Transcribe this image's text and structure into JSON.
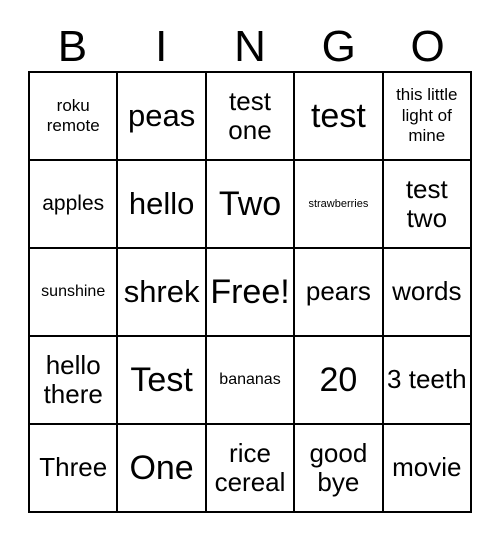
{
  "card": {
    "title": "BINGO",
    "headers": [
      "B",
      "I",
      "N",
      "G",
      "O"
    ],
    "rows": [
      [
        {
          "text": "roku remote",
          "size": "s"
        },
        {
          "text": "peas",
          "size": "xl"
        },
        {
          "text": "test one",
          "size": "l"
        },
        {
          "text": "test",
          "size": "xxl"
        },
        {
          "text": "this little light of mine",
          "size": "s"
        }
      ],
      [
        {
          "text": "apples",
          "size": "m"
        },
        {
          "text": "hello",
          "size": "xl"
        },
        {
          "text": "Two",
          "size": "xxl"
        },
        {
          "text": "strawberries",
          "size": "xxs"
        },
        {
          "text": "test two",
          "size": "l"
        }
      ],
      [
        {
          "text": "sunshine",
          "size": "xs"
        },
        {
          "text": "shrek",
          "size": "xl"
        },
        {
          "text": "Free!",
          "size": "xxl"
        },
        {
          "text": "pears",
          "size": "l"
        },
        {
          "text": "words",
          "size": "l"
        }
      ],
      [
        {
          "text": "hello there",
          "size": "l"
        },
        {
          "text": "Test",
          "size": "xxl"
        },
        {
          "text": "bananas",
          "size": "xs"
        },
        {
          "text": "20",
          "size": "xxl"
        },
        {
          "text": "3 teeth",
          "size": "l"
        }
      ],
      [
        {
          "text": "Three",
          "size": "l"
        },
        {
          "text": "One",
          "size": "xxl"
        },
        {
          "text": "rice cereal",
          "size": "l"
        },
        {
          "text": "good bye",
          "size": "l"
        },
        {
          "text": "movie",
          "size": "l"
        }
      ]
    ]
  },
  "colors": {
    "border": "#000000",
    "text": "#000000",
    "background": "#ffffff"
  }
}
